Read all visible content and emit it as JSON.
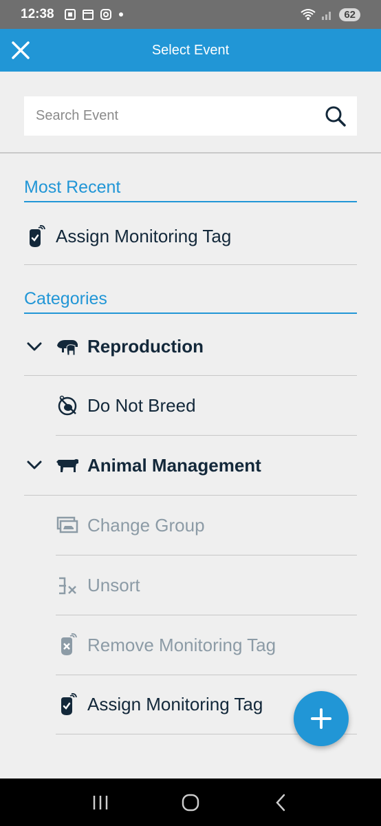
{
  "status_bar": {
    "time": "12:38",
    "battery": "62"
  },
  "header": {
    "title": "Select Event",
    "close_icon": "close-icon"
  },
  "search": {
    "placeholder": "Search Event",
    "value": "",
    "icon": "search-icon"
  },
  "most_recent": {
    "heading": "Most Recent",
    "items": [
      {
        "label": "Assign Monitoring Tag",
        "icon": "monitoring-tag-icon"
      }
    ]
  },
  "categories": {
    "heading": "Categories",
    "groups": [
      {
        "label": "Reproduction",
        "icon": "reproduction-icon",
        "expanded": true,
        "items": [
          {
            "label": "Do Not Breed",
            "icon": "do-not-breed-icon",
            "enabled": true
          }
        ]
      },
      {
        "label": "Animal Management",
        "icon": "cow-icon",
        "expanded": true,
        "items": [
          {
            "label": "Change Group",
            "icon": "change-group-icon",
            "enabled": false
          },
          {
            "label": "Unsort",
            "icon": "unsort-icon",
            "enabled": false
          },
          {
            "label": "Remove Monitoring Tag",
            "icon": "remove-tag-icon",
            "enabled": false
          },
          {
            "label": "Assign Monitoring Tag",
            "icon": "monitoring-tag-icon",
            "enabled": true
          }
        ]
      }
    ]
  },
  "fab": {
    "icon": "plus-icon"
  },
  "colors": {
    "accent": "#2196d6",
    "text": "#13283a",
    "disabled": "#8c9ba6",
    "background": "#efefef"
  }
}
